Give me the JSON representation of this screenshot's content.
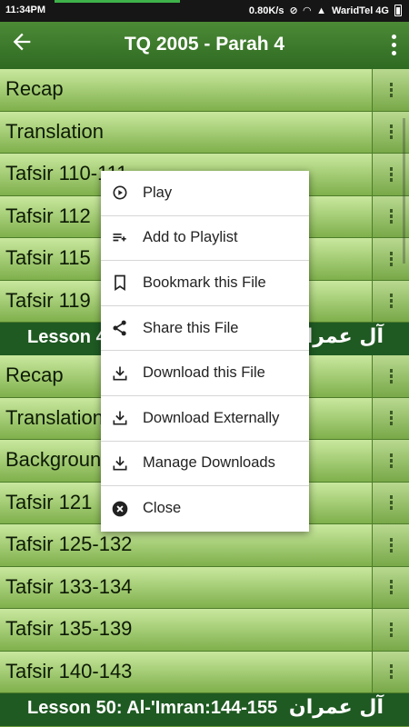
{
  "status_bar": {
    "time": "11:34PM",
    "speed": "0.80K/s",
    "carrier": "WaridTel 4G"
  },
  "app_bar": {
    "title": "TQ 2005 - Parah 4"
  },
  "list": {
    "rows_top": [
      "Recap",
      "Translation",
      "Tafsir 110-111",
      "Tafsir 112",
      "Tafsir 115",
      "Tafsir 119"
    ],
    "header1": {
      "label": "Lesson 49: Al-'Imran",
      "arabic": "آل عمران"
    },
    "rows_mid": [
      "Recap",
      "Translation",
      "Background",
      "Tafsir 121",
      "Tafsir 125-132",
      "Tafsir 133-134",
      "Tafsir 135-139",
      "Tafsir 140-143"
    ],
    "header2": {
      "label": "Lesson 50: Al-'Imran:144-155",
      "arabic": "آل عمران"
    }
  },
  "popup": {
    "items": [
      {
        "label": "Play",
        "icon": "play-circle-icon"
      },
      {
        "label": "Add to Playlist",
        "icon": "playlist-add-icon"
      },
      {
        "label": "Bookmark this File",
        "icon": "bookmark-icon"
      },
      {
        "label": "Share this File",
        "icon": "share-icon"
      },
      {
        "label": "Download this File",
        "icon": "download-icon"
      },
      {
        "label": "Download Externally",
        "icon": "download-icon"
      },
      {
        "label": "Manage Downloads",
        "icon": "download-icon"
      },
      {
        "label": "Close",
        "icon": "close-circle-icon"
      }
    ]
  }
}
